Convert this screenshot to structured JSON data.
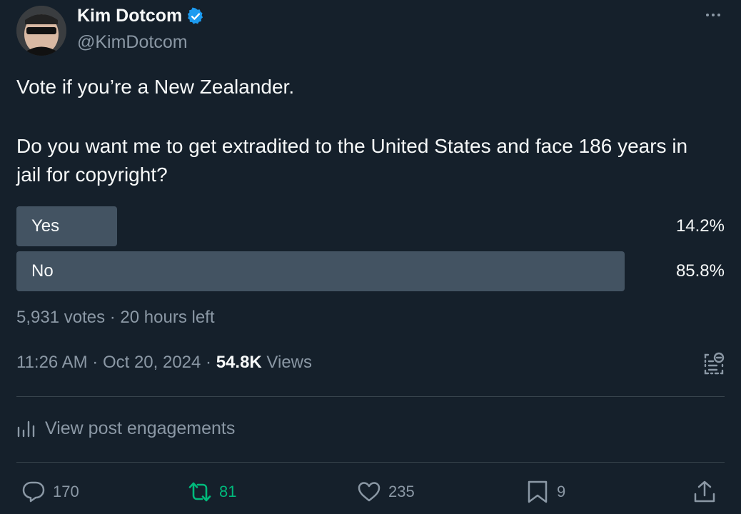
{
  "author": {
    "name": "Kim Dotcom",
    "handle": "@KimDotcom"
  },
  "post": {
    "line1": "Vote if you’re a New Zealander.",
    "line2": "Do you want me to get extradited to the United States and face 186 years in jail for copyright?"
  },
  "poll": {
    "options": [
      {
        "label": "Yes",
        "percent": "14.2%",
        "fraction": 0.142
      },
      {
        "label": "No",
        "percent": "85.8%",
        "fraction": 0.858
      }
    ],
    "meta": "5,931 votes · 20 hours left"
  },
  "meta": {
    "time": "11:26 AM · Oct 20, 2024 · ",
    "views_count": "54.8K",
    "views_label": " Views"
  },
  "engagements_label": "View post engagements",
  "actions": {
    "reply": "170",
    "retweet": "81",
    "like": "235",
    "bookmark": "9"
  },
  "colors": {
    "background": "#15202b",
    "poll_bar": "#435362",
    "retweet_accent": "#00ba7c",
    "verified": "#1d9bf0"
  }
}
